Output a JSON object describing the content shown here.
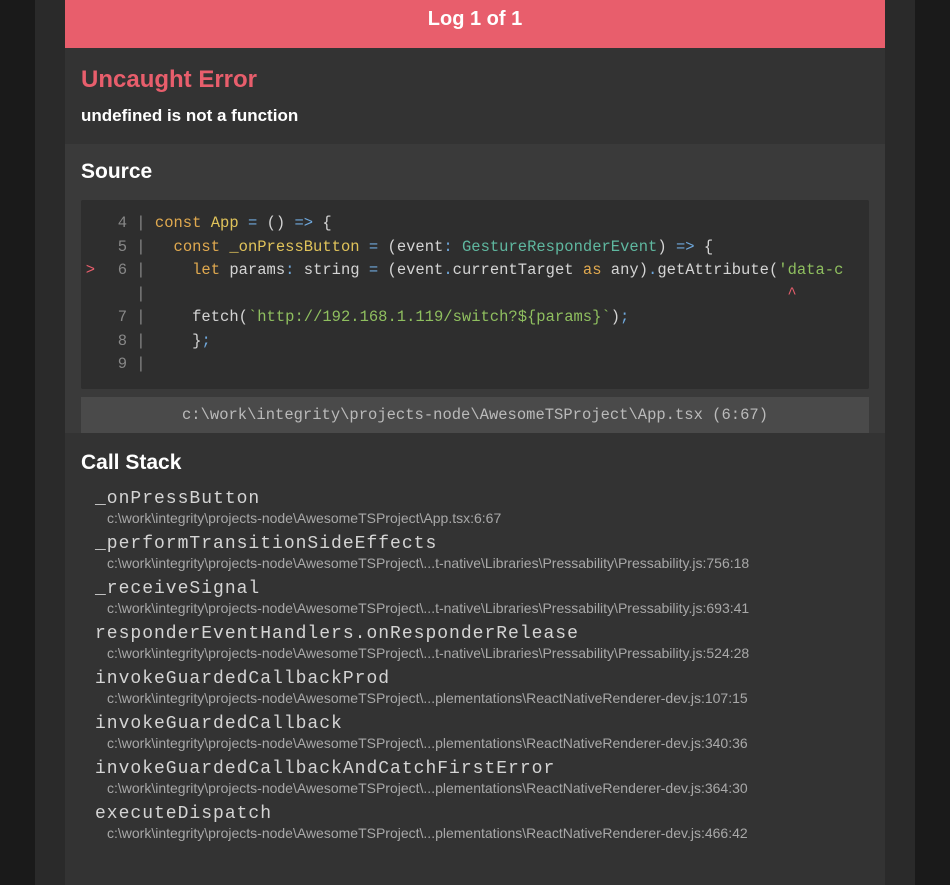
{
  "header": {
    "log_title": "Log 1 of 1"
  },
  "error": {
    "title": "Uncaught Error",
    "message": "undefined is not a function"
  },
  "source": {
    "title": "Source",
    "file_path": "c:\\work\\integrity\\projects-node\\AwesomeTSProject\\App.tsx (6:67)",
    "lines": [
      {
        "num": "4",
        "marker": " ",
        "tokens": [
          {
            "cls": "k-const",
            "t": "const"
          },
          {
            "cls": "ident",
            "t": " "
          },
          {
            "cls": "fn-name",
            "t": "App"
          },
          {
            "cls": "ident",
            "t": " "
          },
          {
            "cls": "op",
            "t": "="
          },
          {
            "cls": "ident",
            "t": " "
          },
          {
            "cls": "punct",
            "t": "()"
          },
          {
            "cls": "ident",
            "t": " "
          },
          {
            "cls": "op",
            "t": "=>"
          },
          {
            "cls": "ident",
            "t": " "
          },
          {
            "cls": "punct",
            "t": "{"
          }
        ]
      },
      {
        "num": "5",
        "marker": " ",
        "tokens": [
          {
            "cls": "ident",
            "t": "  "
          },
          {
            "cls": "k-const",
            "t": "const"
          },
          {
            "cls": "ident",
            "t": " "
          },
          {
            "cls": "fn-name",
            "t": "_onPressButton"
          },
          {
            "cls": "ident",
            "t": " "
          },
          {
            "cls": "op",
            "t": "="
          },
          {
            "cls": "ident",
            "t": " "
          },
          {
            "cls": "punct",
            "t": "("
          },
          {
            "cls": "ident",
            "t": "event"
          },
          {
            "cls": "op",
            "t": ":"
          },
          {
            "cls": "ident",
            "t": " "
          },
          {
            "cls": "type",
            "t": "GestureResponderEvent"
          },
          {
            "cls": "punct",
            "t": ")"
          },
          {
            "cls": "ident",
            "t": " "
          },
          {
            "cls": "op",
            "t": "=>"
          },
          {
            "cls": "ident",
            "t": " "
          },
          {
            "cls": "punct",
            "t": "{"
          }
        ]
      },
      {
        "num": "6",
        "marker": ">",
        "tokens": [
          {
            "cls": "ident",
            "t": "    "
          },
          {
            "cls": "k-let",
            "t": "let"
          },
          {
            "cls": "ident",
            "t": " params"
          },
          {
            "cls": "op",
            "t": ":"
          },
          {
            "cls": "ident",
            "t": " string "
          },
          {
            "cls": "op",
            "t": "="
          },
          {
            "cls": "ident",
            "t": " "
          },
          {
            "cls": "punct",
            "t": "("
          },
          {
            "cls": "ident",
            "t": "event"
          },
          {
            "cls": "op",
            "t": "."
          },
          {
            "cls": "ident",
            "t": "currentTarget "
          },
          {
            "cls": "k-as",
            "t": "as"
          },
          {
            "cls": "ident",
            "t": " any"
          },
          {
            "cls": "punct",
            "t": ")"
          },
          {
            "cls": "op",
            "t": "."
          },
          {
            "cls": "ident",
            "t": "getAttribute"
          },
          {
            "cls": "punct",
            "t": "("
          },
          {
            "cls": "str",
            "t": "'data-c"
          }
        ]
      },
      {
        "num": " ",
        "marker": " ",
        "tokens": [
          {
            "cls": "ident",
            "t": "                                                                    "
          },
          {
            "cls": "caret",
            "t": "^"
          }
        ]
      },
      {
        "num": "7",
        "marker": " ",
        "tokens": [
          {
            "cls": "ident",
            "t": "    "
          },
          {
            "cls": "ident",
            "t": "fetch"
          },
          {
            "cls": "punct",
            "t": "("
          },
          {
            "cls": "str",
            "t": "`http://192.168.1.119/switch?${params}`"
          },
          {
            "cls": "punct",
            "t": ")"
          },
          {
            "cls": "op",
            "t": ";"
          }
        ]
      },
      {
        "num": "8",
        "marker": " ",
        "tokens": [
          {
            "cls": "ident",
            "t": "    "
          },
          {
            "cls": "punct",
            "t": "}"
          },
          {
            "cls": "op",
            "t": ";"
          }
        ]
      },
      {
        "num": "9",
        "marker": " ",
        "tokens": []
      }
    ]
  },
  "callstack": {
    "title": "Call Stack",
    "frames": [
      {
        "fn": "_onPressButton",
        "loc": "c:\\work\\integrity\\projects-node\\AwesomeTSProject\\App.tsx:6:67"
      },
      {
        "fn": "_performTransitionSideEffects",
        "loc": "c:\\work\\integrity\\projects-node\\AwesomeTSProject\\...t-native\\Libraries\\Pressability\\Pressability.js:756:18"
      },
      {
        "fn": "_receiveSignal",
        "loc": "c:\\work\\integrity\\projects-node\\AwesomeTSProject\\...t-native\\Libraries\\Pressability\\Pressability.js:693:41"
      },
      {
        "fn": "responderEventHandlers.onResponderRelease",
        "loc": "c:\\work\\integrity\\projects-node\\AwesomeTSProject\\...t-native\\Libraries\\Pressability\\Pressability.js:524:28"
      },
      {
        "fn": "invokeGuardedCallbackProd",
        "loc": "c:\\work\\integrity\\projects-node\\AwesomeTSProject\\...plementations\\ReactNativeRenderer-dev.js:107:15"
      },
      {
        "fn": "invokeGuardedCallback",
        "loc": "c:\\work\\integrity\\projects-node\\AwesomeTSProject\\...plementations\\ReactNativeRenderer-dev.js:340:36"
      },
      {
        "fn": "invokeGuardedCallbackAndCatchFirstError",
        "loc": "c:\\work\\integrity\\projects-node\\AwesomeTSProject\\...plementations\\ReactNativeRenderer-dev.js:364:30"
      },
      {
        "fn": "executeDispatch",
        "loc": "c:\\work\\integrity\\projects-node\\AwesomeTSProject\\...plementations\\ReactNativeRenderer-dev.js:466:42"
      }
    ]
  }
}
